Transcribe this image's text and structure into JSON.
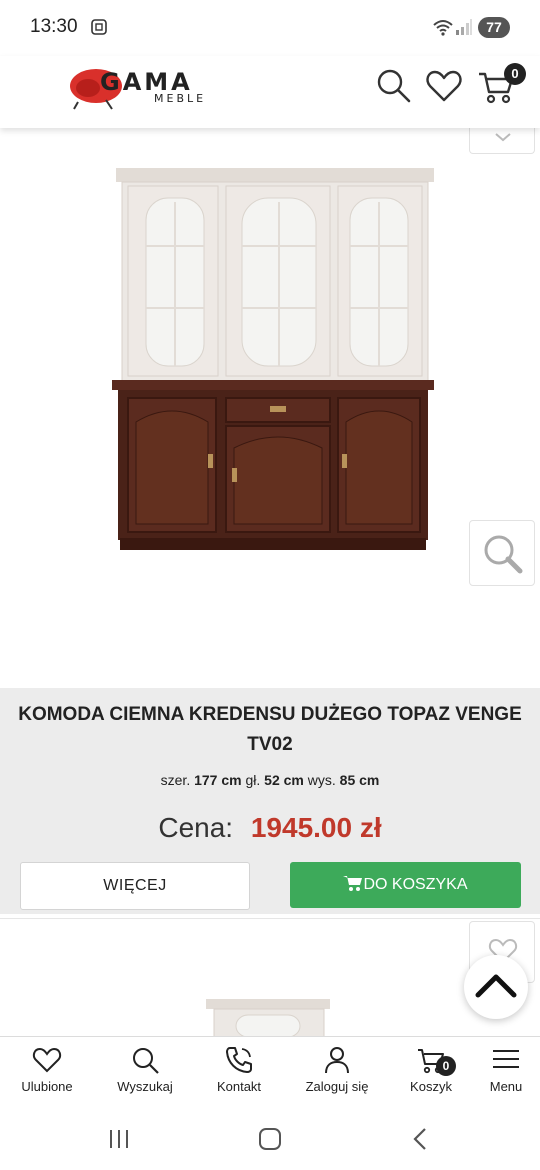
{
  "status_bar": {
    "time": "13:30",
    "battery": "77"
  },
  "header": {
    "logo_text": "GAMA",
    "logo_subtext": "MEBLE",
    "cart_count": "0",
    "icons": [
      "search-icon",
      "heart-icon",
      "cart-icon"
    ]
  },
  "product": {
    "title": "KOMODA CIEMNA KREDENSU DUŻEGO TOPAZ VENGE TV02",
    "dims": {
      "width_label": "szer.",
      "width_value": "177 cm",
      "depth_label": "gł.",
      "depth_value": "52 cm",
      "height_label": "wys.",
      "height_value": "85 cm"
    },
    "price_label": "Cena:",
    "price_value": "1945.00 zł",
    "more_button": "WIĘCEJ",
    "cart_button": "DO KOSZYKA"
  },
  "bottom_nav": {
    "items": [
      {
        "label": "Ulubione",
        "icon": "heart-icon"
      },
      {
        "label": "Wyszukaj",
        "icon": "search-icon"
      },
      {
        "label": "Kontakt",
        "icon": "phone-icon"
      },
      {
        "label": "Zaloguj się",
        "icon": "user-icon"
      },
      {
        "label": "Koszyk",
        "icon": "cart-icon",
        "badge": "0"
      },
      {
        "label": "Menu",
        "icon": "menu-icon"
      }
    ]
  },
  "colors": {
    "price": "#c0392b",
    "cart_button": "#3daa5a",
    "info_background": "#ececec",
    "logo_red": "#d9302b"
  }
}
